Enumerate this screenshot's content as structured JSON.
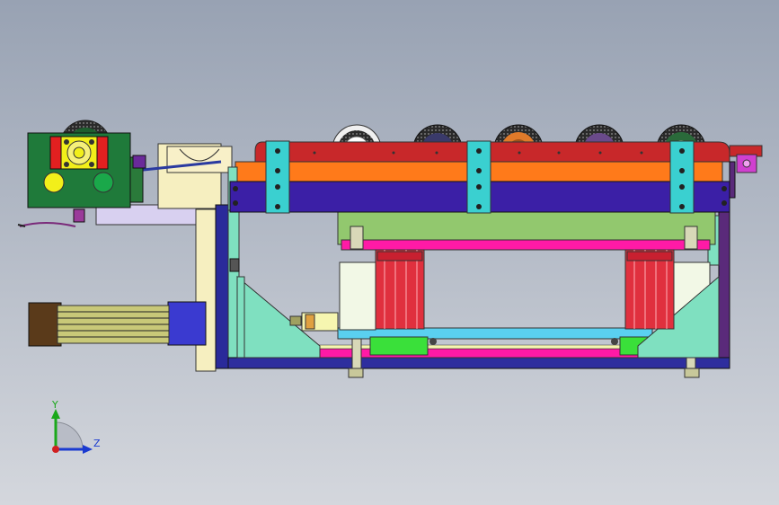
{
  "triad": {
    "y_label": "Y",
    "z_label": "Z"
  },
  "colors": {
    "background_top": "#9aa4b4",
    "background_bottom": "#d2d5db",
    "conveyor_rail": "#c8282a",
    "lift_bar": "#3b1fa6",
    "side_plate": "#ff7a1a",
    "clamp": "#3ad0d0",
    "motor_box": "#1f7a3a",
    "cylinder": "#e0303e",
    "top_plate": "#ff1aa6",
    "base": "#2e2e9e",
    "gusset": "#7fe0c0",
    "frame_plate": "#92c86e"
  }
}
